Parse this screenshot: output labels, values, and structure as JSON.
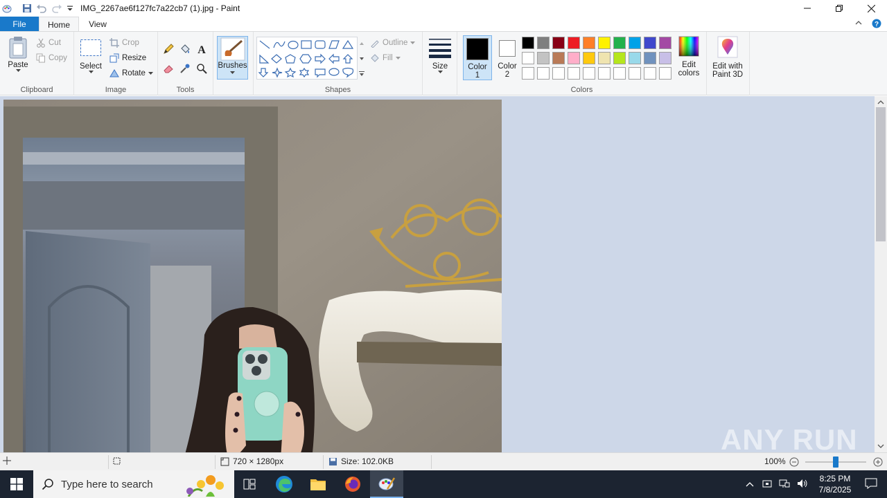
{
  "window": {
    "title": "IMG_2267ae6f127fc7a22cb7 (1).jpg - Paint",
    "app_icon": "paint-icon"
  },
  "tabs": [
    {
      "label": "File"
    },
    {
      "label": "Home"
    },
    {
      "label": "View"
    }
  ],
  "ribbon": {
    "clipboard": {
      "label": "Clipboard",
      "paste": "Paste",
      "cut": "Cut",
      "copy": "Copy"
    },
    "image": {
      "label": "Image",
      "select": "Select",
      "crop": "Crop",
      "resize": "Resize",
      "rotate": "Rotate"
    },
    "tools": {
      "label": "Tools"
    },
    "brushes": {
      "label": "Brushes"
    },
    "shapes": {
      "label": "Shapes",
      "outline": "Outline",
      "fill": "Fill"
    },
    "size": {
      "label": "Size"
    },
    "colors": {
      "label": "Colors",
      "color1": "Color 1",
      "color1_line1": "Color",
      "color1_line2": "1",
      "color2_line1": "Color",
      "color2_line2": "2",
      "color1_value": "#000000",
      "color2_value": "#ffffff",
      "edit_colors_line1": "Edit",
      "edit_colors_line2": "colors",
      "palette_row1": [
        "#000000",
        "#7f7f7f",
        "#880015",
        "#ed1c24",
        "#ff7f27",
        "#fff200",
        "#22b14c",
        "#00a2e8",
        "#3f48cc",
        "#a349a4"
      ],
      "palette_row2": [
        "#ffffff",
        "#c3c3c3",
        "#b97a57",
        "#ffaec9",
        "#ffc90e",
        "#efe4b0",
        "#b5e61d",
        "#99d9ea",
        "#7092be",
        "#c8bfe7"
      ],
      "palette_row3": [
        "#ffffff",
        "#ffffff",
        "#ffffff",
        "#ffffff",
        "#ffffff",
        "#ffffff",
        "#ffffff",
        "#ffffff",
        "#ffffff",
        "#ffffff"
      ]
    },
    "paint3d": {
      "line1": "Edit with",
      "line2": "Paint 3D"
    }
  },
  "status": {
    "dimensions": "720 × 1280px",
    "size": "Size: 102.0KB",
    "zoom": "100%",
    "zoom_level": 0.5
  },
  "watermark": "ANY RUN",
  "taskbar": {
    "search_placeholder": "Type here to search",
    "time": "8:25 PM",
    "date": "7/8/2025"
  }
}
